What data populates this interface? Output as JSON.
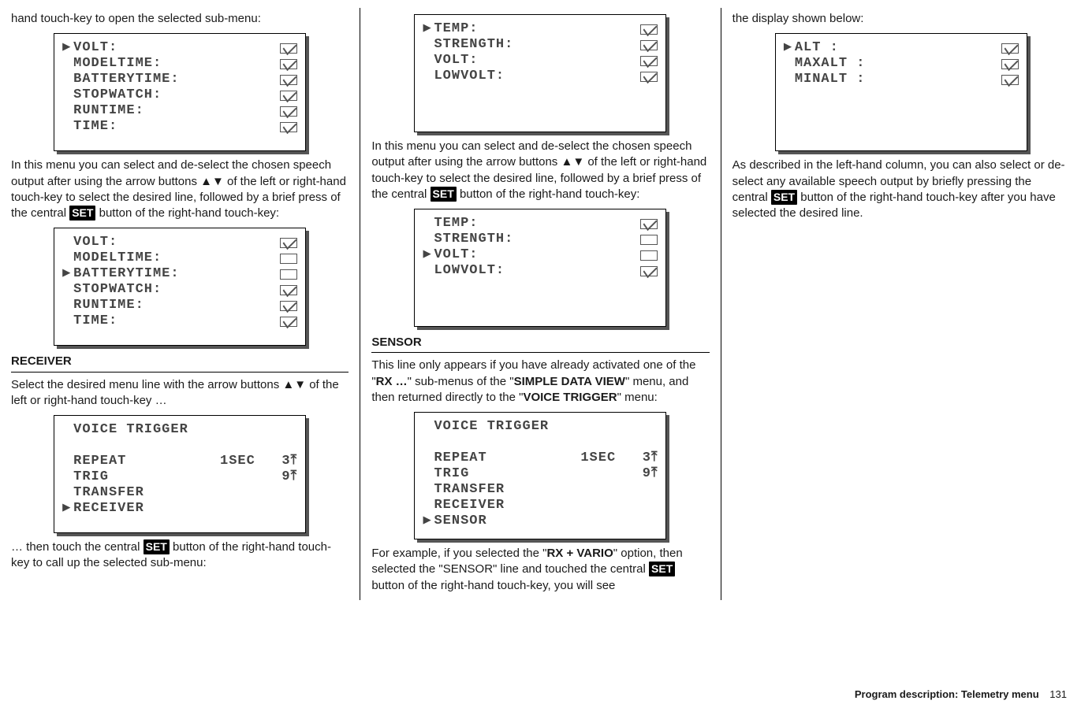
{
  "col1": {
    "intro": "hand touch-key to open the selected sub-menu:",
    "lcd1": [
      {
        "ptr": true,
        "label": "VOLT:",
        "box": "checked"
      },
      {
        "ptr": false,
        "label": "MODELTIME:",
        "box": "checked"
      },
      {
        "ptr": false,
        "label": "BATTERYTIME:",
        "box": "checked"
      },
      {
        "ptr": false,
        "label": "STOPWATCH:",
        "box": "checked"
      },
      {
        "ptr": false,
        "label": "RUNTIME:",
        "box": "checked"
      },
      {
        "ptr": false,
        "label": "TIME:",
        "box": "checked"
      }
    ],
    "para1a": "In this menu you can select and de-select the chosen speech output after using the arrow buttons ▲▼ of the left or right-hand touch-key to select the desired line, followed by a brief press of the central ",
    "para1b": " button of the right-hand touch-key:",
    "set": "SET",
    "lcd2": [
      {
        "ptr": false,
        "label": "VOLT:",
        "box": "checked"
      },
      {
        "ptr": false,
        "label": "MODELTIME:",
        "box": "empty"
      },
      {
        "ptr": true,
        "label": "BATTERYTIME:",
        "box": "empty"
      },
      {
        "ptr": false,
        "label": "STOPWATCH:",
        "box": "checked"
      },
      {
        "ptr": false,
        "label": "RUNTIME:",
        "box": "checked"
      },
      {
        "ptr": false,
        "label": "TIME:",
        "box": "checked"
      }
    ],
    "receiver_heading": "RECEIVER",
    "receiver_text": "Select the desired menu line with the arrow buttons ▲▼ of the left or right-hand touch-key …",
    "lcd3_title": "VOICE TRIGGER",
    "lcd3": [
      {
        "ptr": false,
        "label": "REPEAT",
        "val": "1SEC   3⤒"
      },
      {
        "ptr": false,
        "label": "TRIG",
        "val": "       9⤒"
      },
      {
        "ptr": false,
        "label": "TRANSFER",
        "val": ""
      },
      {
        "ptr": true,
        "label": "RECEIVER",
        "val": ""
      }
    ],
    "after3a": "… then touch the central ",
    "after3b": " button of the right-hand touch-key to call up the selected sub-menu:"
  },
  "col2": {
    "lcd4": [
      {
        "ptr": true,
        "label": "TEMP:",
        "box": "checked"
      },
      {
        "ptr": false,
        "label": "STRENGTH:",
        "box": "checked"
      },
      {
        "ptr": false,
        "label": "VOLT:",
        "box": "checked"
      },
      {
        "ptr": false,
        "label": "LOWVOLT:",
        "box": "checked"
      }
    ],
    "para4a": "In this menu you can select and de-select the chosen speech output after using the arrow buttons ▲▼ of the left or right-hand touch-key to select the desired line, followed by a brief press of the central ",
    "para4b": " button of the right-hand touch-key:",
    "set": "SET",
    "lcd5": [
      {
        "ptr": false,
        "label": "TEMP:",
        "box": "checked"
      },
      {
        "ptr": false,
        "label": "STRENGTH:",
        "box": "empty"
      },
      {
        "ptr": true,
        "label": "VOLT:",
        "box": "empty"
      },
      {
        "ptr": false,
        "label": "LOWVOLT:",
        "box": "checked"
      }
    ],
    "sensor_heading": "SENSOR",
    "sensor_text1": "This line only appears if you have already activated one of the \"",
    "sensor_bold1": "RX …",
    "sensor_text2": "\" sub-menus of the \"",
    "sensor_bold2": "SIMPLE DATA VIEW",
    "sensor_text3": "\" menu, and then returned directly to the \"",
    "sensor_bold3": "VOICE TRIGGER",
    "sensor_text4": "\" menu:",
    "lcd6_title": "VOICE TRIGGER",
    "lcd6": [
      {
        "ptr": false,
        "label": "REPEAT",
        "val": "1SEC   3⤒"
      },
      {
        "ptr": false,
        "label": "TRIG",
        "val": "       9⤒"
      },
      {
        "ptr": false,
        "label": "TRANSFER",
        "val": ""
      },
      {
        "ptr": false,
        "label": "RECEIVER",
        "val": ""
      },
      {
        "ptr": true,
        "label": "SENSOR",
        "val": ""
      }
    ],
    "para6a": "For example, if you selected the \"",
    "para6_bold": "RX + VARIO",
    "para6b": "\" option, then selected the \"SENSOR\" line and touched the central ",
    "para6c": " button of the right-hand touch-key, you will see"
  },
  "col3": {
    "intro": "the display shown below:",
    "lcd7": [
      {
        "ptr": true,
        "label": "ALT :",
        "box": "checked"
      },
      {
        "ptr": false,
        "label": "MAXALT :",
        "box": "checked"
      },
      {
        "ptr": false,
        "label": "MINALT :",
        "box": "checked"
      }
    ],
    "para7a": "As described in the left-hand column, you can also select or de-select any available speech output by briefly pressing the central ",
    "para7b": " button of the right-hand touch-key after you have selected the desired line.",
    "set": "SET"
  },
  "footer": {
    "title": "Program description: Telemetry menu",
    "page": "131"
  }
}
